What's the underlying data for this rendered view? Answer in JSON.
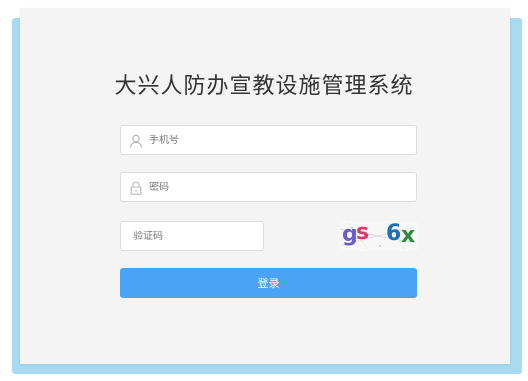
{
  "title": "大兴人防办宣教设施管理系统",
  "form": {
    "phone_placeholder": "手机号",
    "password_placeholder": "密码",
    "captcha_placeholder": "验证码",
    "captcha_text": "gs 6x",
    "captcha_chars": [
      {
        "char": "g",
        "color": "#6b5fc7"
      },
      {
        "char": "s",
        "color": "#d83a6d"
      },
      {
        "char": "6",
        "color": "#1f6db8"
      },
      {
        "char": "x",
        "color": "#2e8b3a"
      }
    ],
    "submit_label": "登录"
  },
  "colors": {
    "accent": "#4aa3f7",
    "background_band": "#a9daf0",
    "card": "#f4f4f4"
  },
  "icons": {
    "phone": "user-icon",
    "password": "lock-icon"
  }
}
